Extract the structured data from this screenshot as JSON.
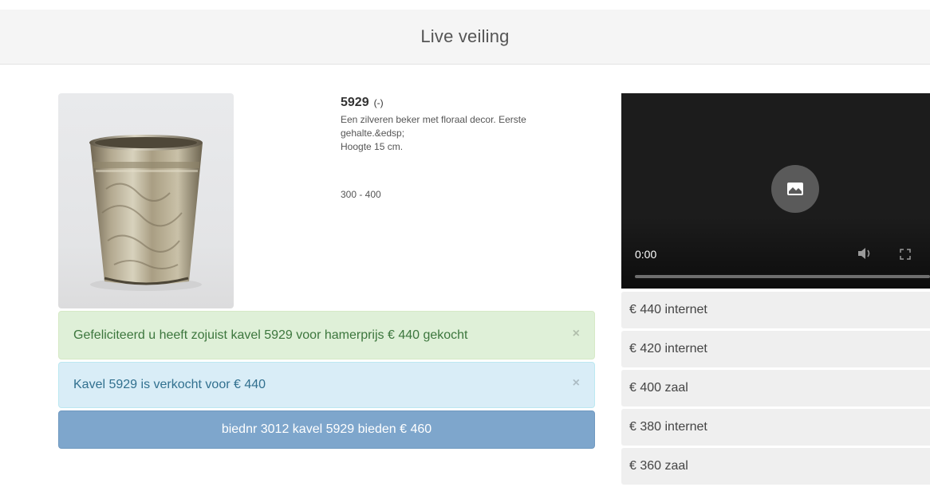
{
  "header": {
    "title": "Live veiling"
  },
  "lot": {
    "number": "5929",
    "status": "(-)",
    "description_lines": [
      "Een zilveren beker met floraal decor. Eerste",
      "gehalte.&edsp;",
      "Hoogte 15 cm."
    ],
    "estimate": "300 - 400",
    "image_icon": "silver-beaker-photo"
  },
  "video": {
    "time": "0:00",
    "progress": 0,
    "icons": [
      "play-icon",
      "volume-icon",
      "fullscreen-icon"
    ]
  },
  "bids": [
    {
      "label": "€ 440 internet"
    },
    {
      "label": "€ 420 internet"
    },
    {
      "label": "€ 400 zaal"
    },
    {
      "label": "€ 380 internet"
    },
    {
      "label": "€ 360 zaal"
    }
  ],
  "alerts": {
    "success": {
      "text": "Gefeliciteerd u heeft zojuist kavel 5929 voor hamerprijs € 440 gekocht",
      "close": "×"
    },
    "info": {
      "text": "Kavel 5929 is verkocht voor € 440",
      "close": "×"
    }
  },
  "bid_button": {
    "label": "biednr 3012 kavel 5929 bieden € 460"
  },
  "colors": {
    "success_bg": "#dff0d8",
    "info_bg": "#d9edf7",
    "button_bg": "#7ea6cc",
    "video_bg": "#1c1c1c"
  }
}
